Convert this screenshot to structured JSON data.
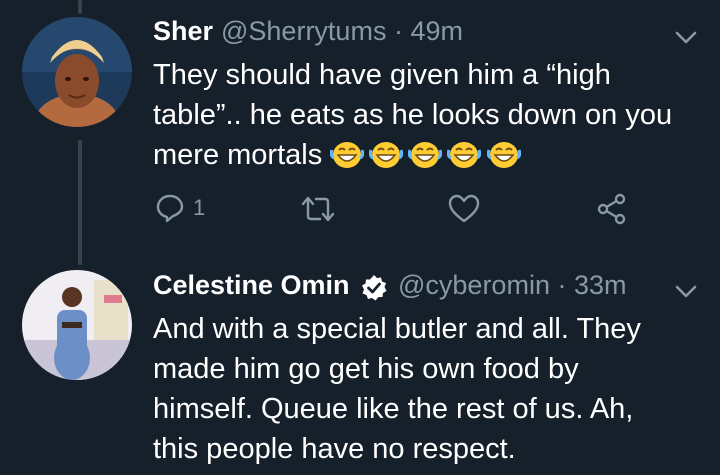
{
  "tweets": [
    {
      "name": "Sher",
      "handle": "@Sherrytums",
      "separator": "·",
      "time": "49m",
      "text": "They should have given him a “high table”.. he eats as he looks down on you mere mortals",
      "emoji": "😂😂😂😂😂",
      "reply_count": "1"
    },
    {
      "name": "Celestine Omin",
      "verified": true,
      "handle": "@cyberomin",
      "separator": "·",
      "time": "33m",
      "text": "And with a special butler and all. They made him go get his own food by himself. Queue like the rest of us. Ah, this people have no respect."
    }
  ],
  "colors": {
    "background": "#15202b",
    "secondary_text": "#8899a6",
    "thread_line": "#38444d",
    "verified": "#ffffff"
  }
}
